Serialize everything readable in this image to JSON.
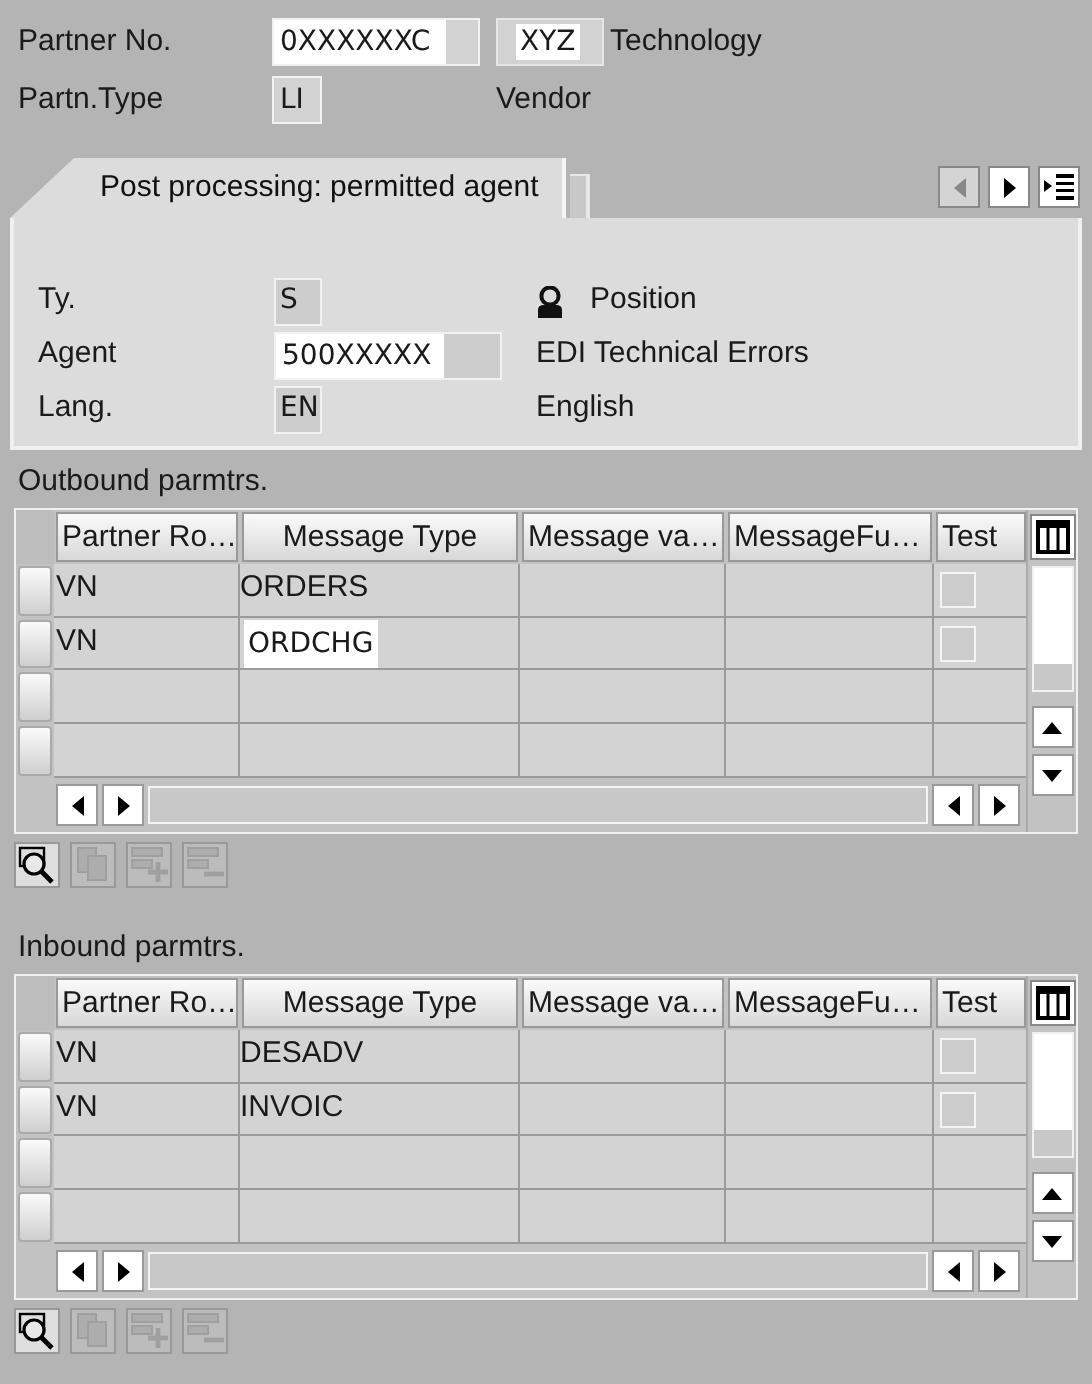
{
  "partner": {
    "number_label": "Partner No.",
    "number": "0XXXXXXC",
    "name_code": "XYZ",
    "name": "Technology",
    "type_label": "Partn.Type",
    "type": "LI",
    "type_text": "Vendor"
  },
  "tabs": [
    {
      "label": "Post processing: permitted agent",
      "selected": true
    }
  ],
  "tab_nav": [
    {
      "kind": "prev",
      "disabled": true
    },
    {
      "kind": "next",
      "disabled": false
    },
    {
      "kind": "list",
      "disabled": false
    }
  ],
  "agent_fields": [
    {
      "label": "Ty.",
      "value": "S",
      "editable": false,
      "icon": true,
      "text": "Position"
    },
    {
      "label": "Agent",
      "value": "500XXXXX",
      "editable": true,
      "icon": false,
      "text": "EDI Technical Errors"
    },
    {
      "label": "Lang.",
      "value": "EN",
      "editable": false,
      "icon": false,
      "text": "English"
    }
  ],
  "tables": [
    {
      "title": "Outbound parmtrs.",
      "columns": [
        "Partner Ro…",
        "Message Type",
        "Message va…",
        "MessageFu…",
        "Test"
      ],
      "rows": [
        {
          "partner_role": "VN",
          "message_type": "ORDERS",
          "highlighted": false,
          "test": false
        },
        {
          "partner_role": "VN",
          "message_type": "ORDCHG",
          "highlighted": true,
          "test": false
        }
      ],
      "toolbar": [
        {
          "kind": "details",
          "disabled": false
        },
        {
          "kind": "copy",
          "disabled": true
        },
        {
          "kind": "insert",
          "disabled": true
        },
        {
          "kind": "delete",
          "disabled": true
        }
      ]
    },
    {
      "title": "Inbound parmtrs.",
      "columns": [
        "Partner Ro…",
        "Message Type",
        "Message va…",
        "MessageFu…",
        "Test"
      ],
      "rows": [
        {
          "partner_role": "VN",
          "message_type": "DESADV",
          "highlighted": false,
          "test": false
        },
        {
          "partner_role": "VN",
          "message_type": "INVOIC",
          "highlighted": false,
          "test": false
        }
      ],
      "toolbar": [
        {
          "kind": "details",
          "disabled": false
        },
        {
          "kind": "copy",
          "disabled": true
        },
        {
          "kind": "insert",
          "disabled": true
        },
        {
          "kind": "delete",
          "disabled": true
        }
      ]
    }
  ]
}
